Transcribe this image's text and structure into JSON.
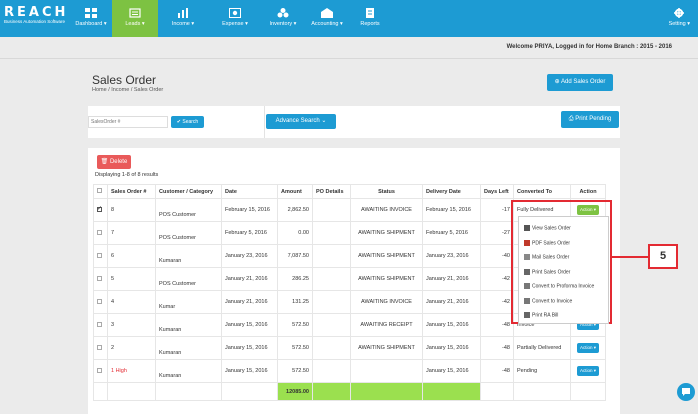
{
  "app": {
    "brand": "REACH",
    "tagline": "Business Automation Software"
  },
  "nav": [
    {
      "label": "Dashboard ▾",
      "icon": "dashboard-icon"
    },
    {
      "label": "Leads ▾",
      "icon": "leads-icon",
      "active": true
    },
    {
      "label": "Income ▾",
      "icon": "income-icon"
    },
    {
      "label": "Expense ▾",
      "icon": "expense-icon"
    },
    {
      "label": "Inventory ▾",
      "icon": "inventory-icon"
    },
    {
      "label": "Accounting ▾",
      "icon": "accounting-icon"
    },
    {
      "label": "Reports",
      "icon": "reports-icon"
    }
  ],
  "setting": {
    "label": "Setting ▾",
    "icon": "gear-icon"
  },
  "welcome": "Welcome PRIYA, Logged in for Home Branch : 2015 - 2016",
  "page": {
    "title": "Sales Order",
    "breadcrumb": "Home  /  Income  /  Sales Order"
  },
  "buttons": {
    "add": "Add Sales Order",
    "search": "Search",
    "advance": "Advance Search",
    "print_pending": "Print Pending",
    "delete": "Delete"
  },
  "search": {
    "placeholder": "SalesOrder #"
  },
  "results": "Displaying 1-8 of 8 results",
  "table": {
    "headers": [
      "Sales Order #",
      "Customer / Category",
      "Date",
      "Amount",
      "PO Details",
      "Status",
      "Delivery Date",
      "Days Left",
      "Converted To",
      "Action"
    ],
    "rows": [
      {
        "no": "8",
        "customer": "POS Customer",
        "date": "February 15, 2016",
        "amount": "2,862.50",
        "po": "",
        "status": "AWAITING INVOICE",
        "delivery": "February 15, 2016",
        "days": "-17",
        "converted": "Fully Delivered",
        "checked": true
      },
      {
        "no": "7",
        "customer": "POS Customer",
        "date": "February 5, 2016",
        "amount": "0.00",
        "po": "",
        "status": "AWAITING SHIPMENT",
        "delivery": "February 5, 2016",
        "days": "-27",
        "converted": "",
        "checked": false
      },
      {
        "no": "6",
        "customer": "Kumaran",
        "date": "January 23, 2016",
        "amount": "7,087.50",
        "po": "",
        "status": "AWAITING SHIPMENT",
        "delivery": "January 23, 2016",
        "days": "-40",
        "converted": "",
        "checked": false
      },
      {
        "no": "5",
        "customer": "POS Customer",
        "date": "January 21, 2016",
        "amount": "286.25",
        "po": "",
        "status": "AWAITING SHIPMENT",
        "delivery": "January 21, 2016",
        "days": "-42",
        "converted": "",
        "checked": false
      },
      {
        "no": "4",
        "customer": "Kumar",
        "date": "January 21, 2016",
        "amount": "131.25",
        "po": "",
        "status": "AWAITING INVOICE",
        "delivery": "January 21, 2016",
        "days": "-42",
        "converted": "",
        "checked": false
      },
      {
        "no": "3",
        "customer": "Kumaran",
        "date": "January 15, 2016",
        "amount": "572.50",
        "po": "",
        "status": "AWAITING RECEIPT",
        "delivery": "January 15, 2016",
        "days": "-48",
        "converted": "Invoice",
        "checked": false
      },
      {
        "no": "2",
        "customer": "Kumaran",
        "date": "January 15, 2016",
        "amount": "572.50",
        "po": "",
        "status": "AWAITING SHIPMENT",
        "delivery": "January 15, 2016",
        "days": "-48",
        "converted": "Partially Delivered",
        "checked": false
      },
      {
        "no": "1 High",
        "customer": "Kumaran",
        "date": "January 15, 2016",
        "amount": "572.50",
        "po": "",
        "status": "",
        "delivery": "January 15, 2016",
        "days": "-48",
        "converted": "Pending",
        "checked": false
      }
    ],
    "total": "12085.00"
  },
  "action_label": "Action ▾",
  "dropdown": [
    {
      "label": "View Sales Order",
      "icon": "search-icon"
    },
    {
      "label": "PDF Sales Order",
      "icon": "pdf-icon"
    },
    {
      "label": "Mail Sales Order",
      "icon": "mail-icon"
    },
    {
      "label": "Print Sales Order",
      "icon": "print-icon"
    },
    {
      "label": "Convert to Proforma Invoice",
      "icon": "convert-icon"
    },
    {
      "label": "Convert to Invoice",
      "icon": "convert-icon"
    },
    {
      "label": "Print RA Bill",
      "icon": "print-icon"
    }
  ],
  "callout": "5",
  "colors": {
    "primary": "#1d9bd3",
    "active": "#7dc242",
    "danger": "#e95a5a",
    "highlight": "#e32a32",
    "total": "#9be04f"
  }
}
